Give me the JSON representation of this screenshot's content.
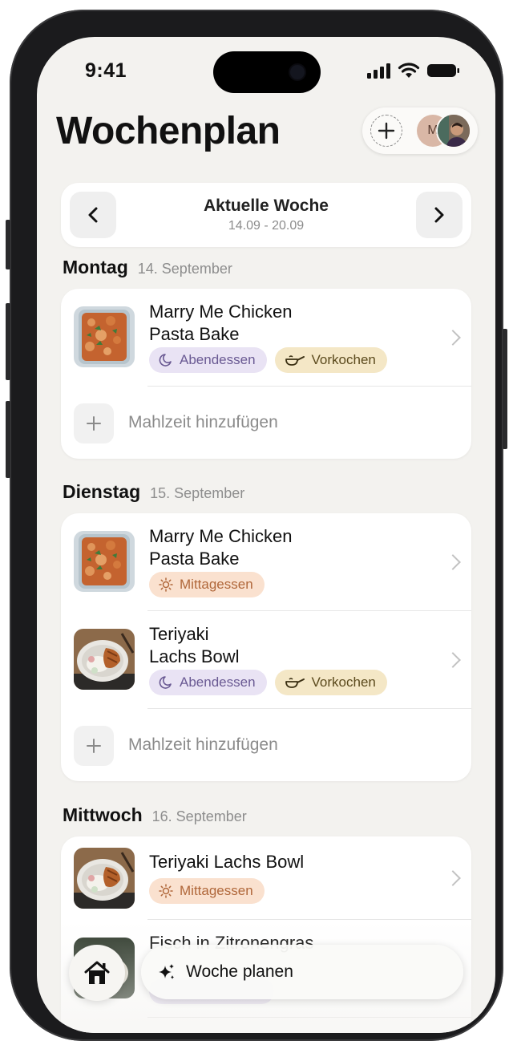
{
  "status": {
    "time": "9:41"
  },
  "header": {
    "title": "Wochenplan",
    "avatar_initial": "M"
  },
  "week_nav": {
    "title": "Aktuelle Woche",
    "range": "14.09 - 20.09"
  },
  "days": [
    {
      "name": "Montag",
      "date": "14. September",
      "meals": [
        {
          "name_line1": "Marry Me Chicken",
          "name_line2": "Pasta Bake",
          "tags": [
            "Abendessen",
            "Vorkochen"
          ]
        }
      ],
      "add_label": "Mahlzeit hinzufügen"
    },
    {
      "name": "Dienstag",
      "date": "15. September",
      "meals": [
        {
          "name_line1": "Marry Me Chicken",
          "name_line2": "Pasta Bake",
          "tags": [
            "Mittagessen"
          ]
        },
        {
          "name_line1": "Teriyaki",
          "name_line2": "Lachs Bowl",
          "tags": [
            "Abendessen",
            "Vorkochen"
          ]
        }
      ],
      "add_label": "Mahlzeit hinzufügen"
    },
    {
      "name": "Mittwoch",
      "date": "16. September",
      "meals": [
        {
          "name": "Teriyaki Lachs Bowl",
          "tags": [
            "Mittagessen"
          ]
        },
        {
          "name": "Fisch in Zitronengras"
        }
      ]
    }
  ],
  "bottom": {
    "plan_label": "Woche planen"
  },
  "icons": {
    "moon": "moon-icon",
    "pan": "pan-icon",
    "sun": "sun-icon",
    "home": "home-icon",
    "sparkles": "sparkles-icon"
  },
  "colors": {
    "background": "#f3f2ef",
    "dinner_tag": "#e9e3f4",
    "prep_tag": "#f4e7c6",
    "lunch_tag": "#fae1cf"
  }
}
